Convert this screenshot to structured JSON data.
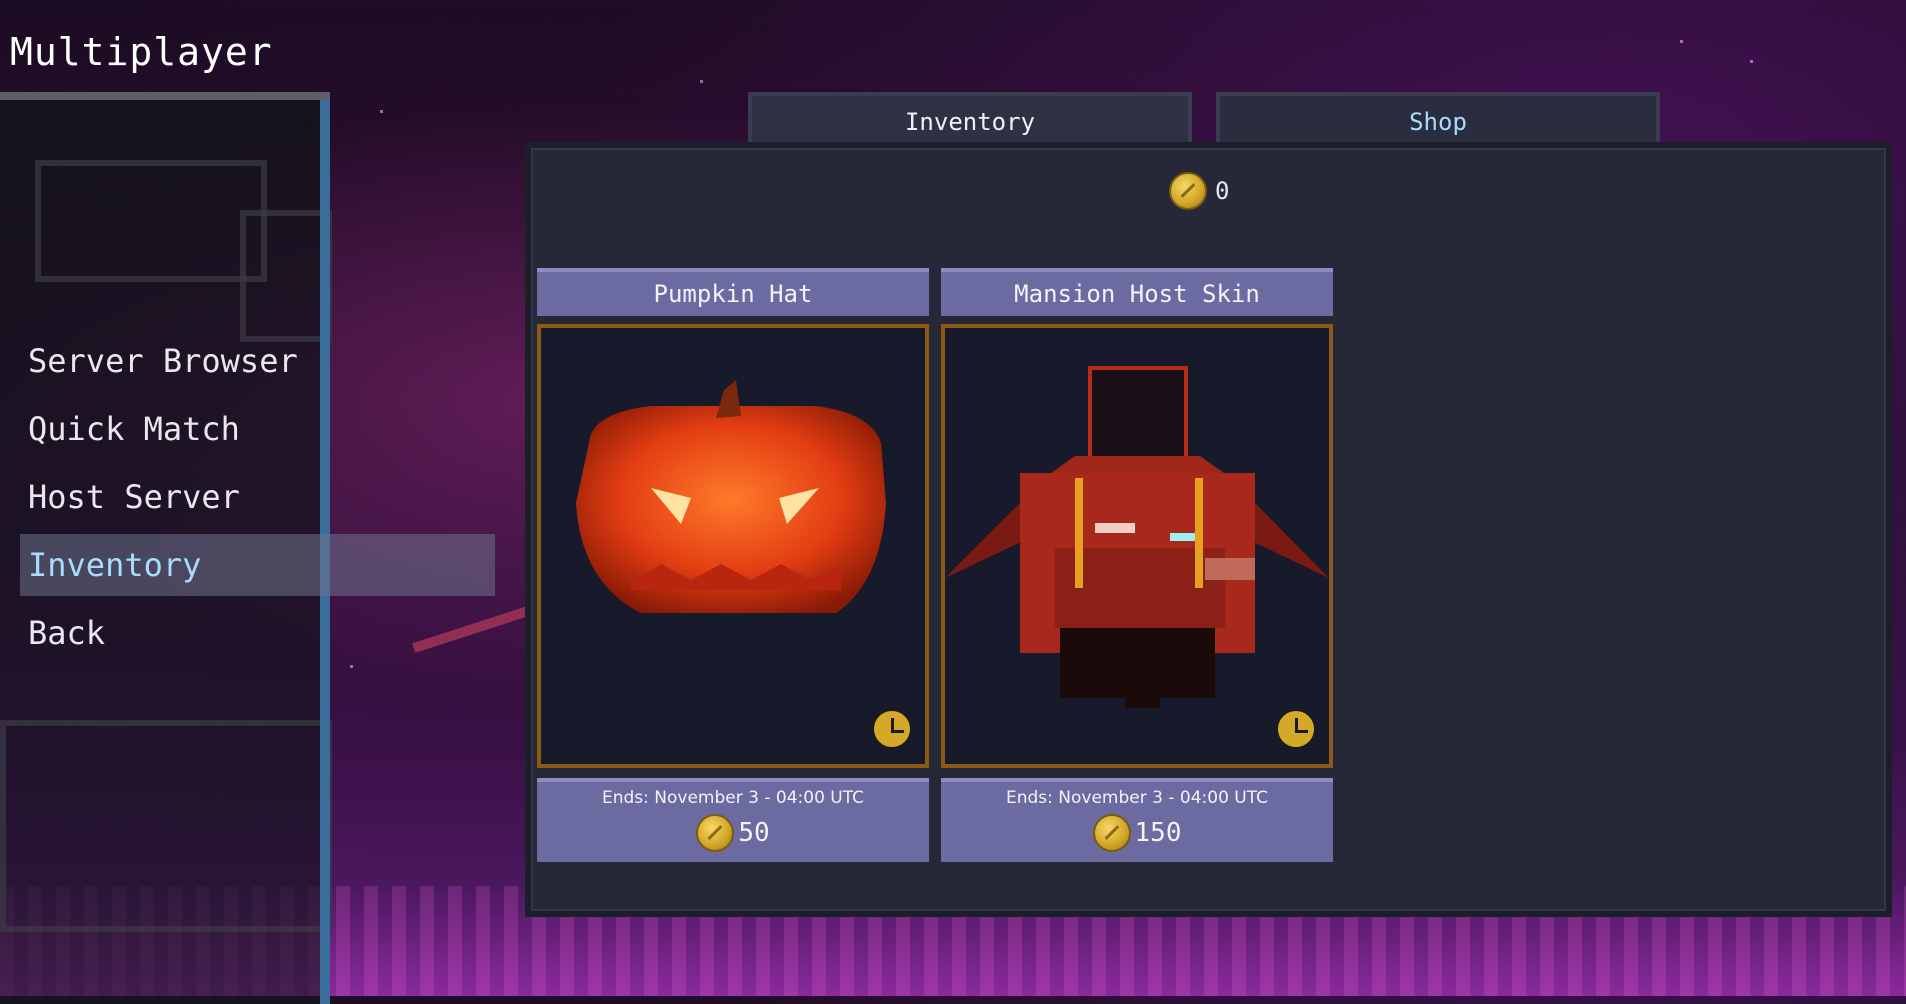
{
  "screen_title": "Multiplayer",
  "menu": {
    "items": [
      {
        "label": "Server Browser",
        "active": false
      },
      {
        "label": "Quick Match",
        "active": false
      },
      {
        "label": "Host Server",
        "active": false
      },
      {
        "label": "Inventory",
        "active": true
      },
      {
        "label": "Back",
        "active": false
      }
    ]
  },
  "tabs": [
    {
      "label": "Inventory",
      "active": true
    },
    {
      "label": "Shop",
      "active": false
    }
  ],
  "balance": {
    "icon": "coin-icon",
    "amount": "0"
  },
  "items": [
    {
      "name": "Pumpkin Hat",
      "ends": "Ends: November 3 - 04:00 UTC",
      "price": "50",
      "image": "pumpkin-hat-image"
    },
    {
      "name": "Mansion Host Skin",
      "ends": "Ends: November 3 - 04:00 UTC",
      "price": "150",
      "image": "mansion-host-skin-image"
    }
  ],
  "colors": {
    "accent": "#a8dcff",
    "card": "#6b6ba2",
    "gold": "#d4a928",
    "frame": "#8c5a14"
  }
}
